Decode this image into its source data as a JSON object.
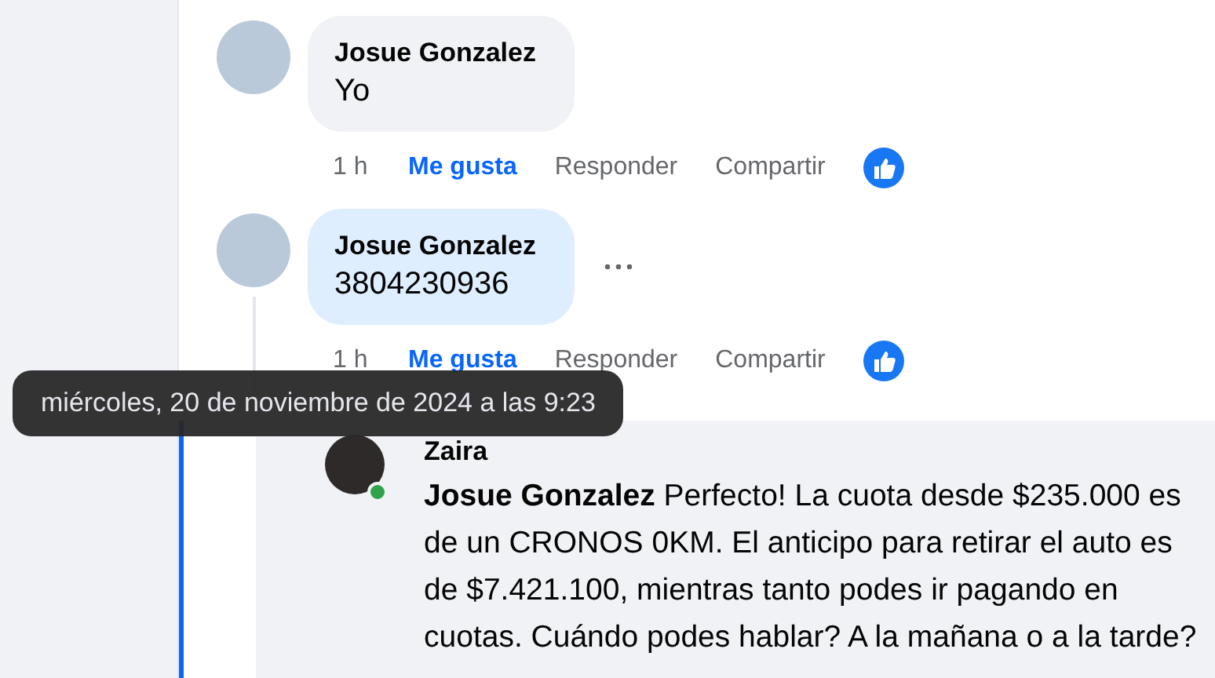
{
  "comments": [
    {
      "author": "Josue Gonzalez",
      "text": "Yo",
      "highlighted": false,
      "has_more": false,
      "time": "1 h",
      "like": "Me gusta",
      "liked": true,
      "reply": "Responder",
      "share": "Compartir",
      "reacted": true
    },
    {
      "author": "Josue Gonzalez",
      "text": "3804230936",
      "highlighted": true,
      "has_more": true,
      "time": "1 h",
      "like": "Me gusta",
      "liked": true,
      "reply": "Responder",
      "share": "Compartir",
      "reacted": true
    }
  ],
  "reply": {
    "author": "Zaira",
    "online": true,
    "text": "**Josue Gonzalez** Perfecto! La cuota desde $235.000 es de un CRONOS 0KM. El anticipo para retirar el auto es de $7.421.100, mientras tanto podes ir pagando en cuotas. Cuándo podes hablar? A la mañana o a la tarde?"
  },
  "tooltip": {
    "text": "miércoles, 20 de noviembre de 2024 a las 9:23"
  }
}
